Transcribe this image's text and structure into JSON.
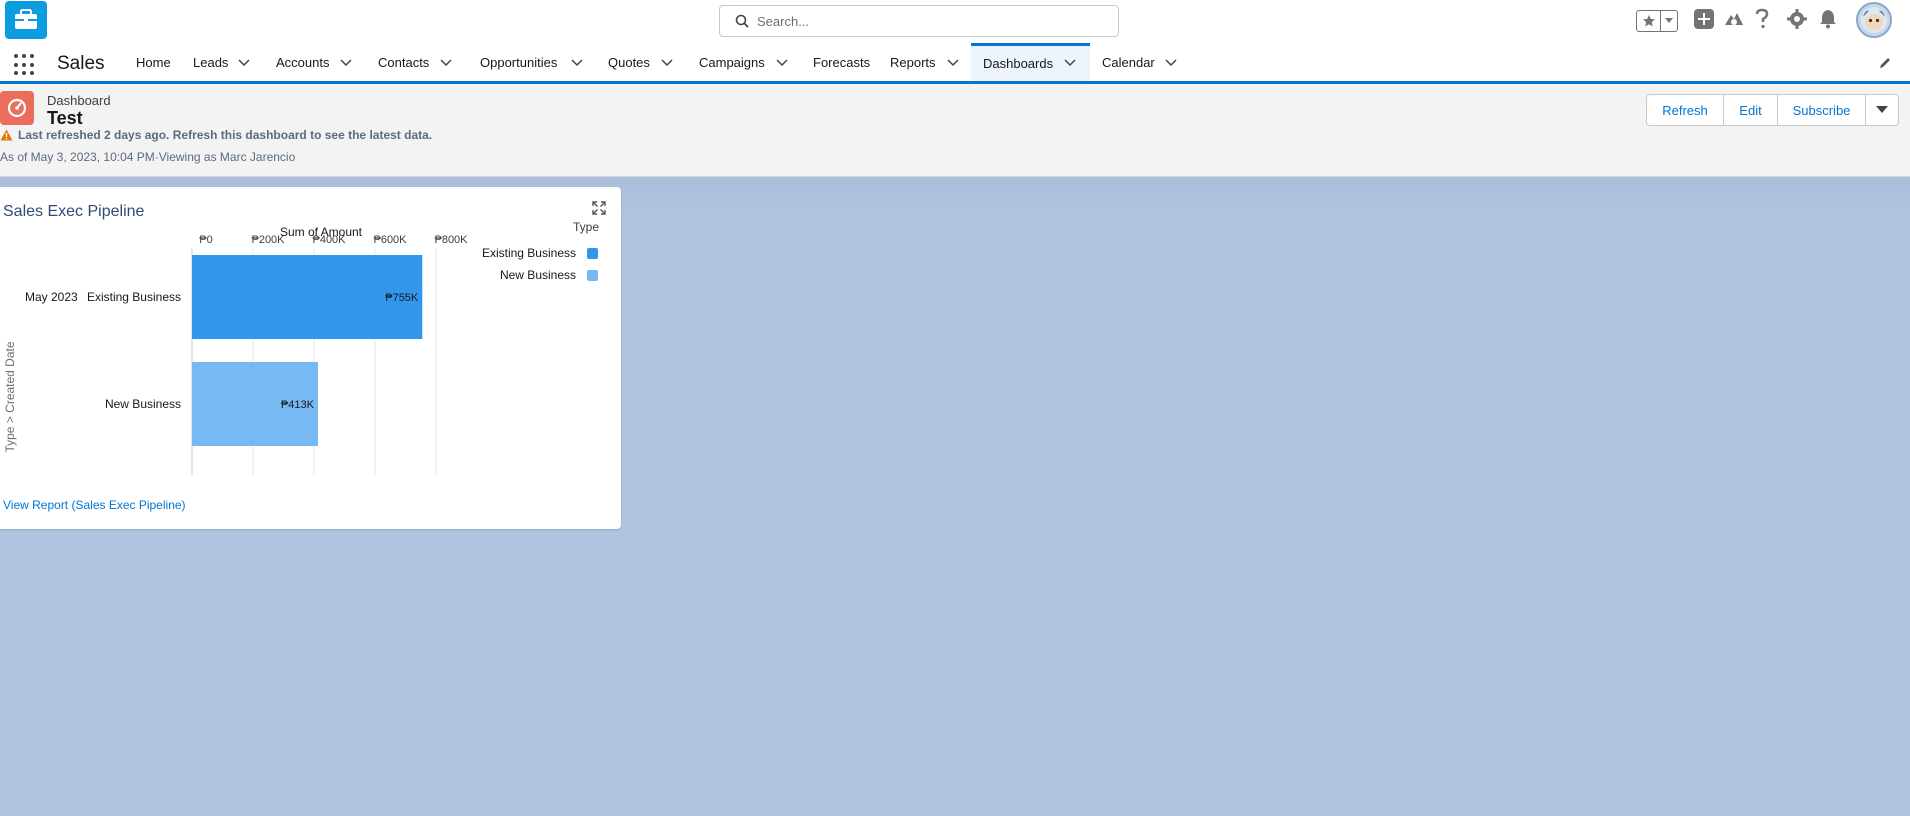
{
  "search": {
    "placeholder": "Search..."
  },
  "app": {
    "name": "Sales"
  },
  "nav": {
    "items": [
      {
        "label": "Home",
        "has_menu": false
      },
      {
        "label": "Leads",
        "has_menu": true
      },
      {
        "label": "Accounts",
        "has_menu": true
      },
      {
        "label": "Contacts",
        "has_menu": true
      },
      {
        "label": "Opportunities",
        "has_menu": true
      },
      {
        "label": "Quotes",
        "has_menu": true
      },
      {
        "label": "Campaigns",
        "has_menu": true
      },
      {
        "label": "Forecasts",
        "has_menu": false
      },
      {
        "label": "Reports",
        "has_menu": true
      },
      {
        "label": "Dashboards",
        "has_menu": true,
        "active": true
      },
      {
        "label": "Calendar",
        "has_menu": true
      }
    ]
  },
  "dashboard": {
    "type_label": "Dashboard",
    "title": "Test",
    "warning": "Last refreshed 2 days ago. Refresh this dashboard to see the latest data.",
    "as_of": "As of May 3, 2023, 10:04 PM·Viewing as Marc Jarencio",
    "buttons": {
      "refresh": "Refresh",
      "edit": "Edit",
      "subscribe": "Subscribe"
    }
  },
  "widget": {
    "title": "Sales Exec Pipeline",
    "view_report": "View Report (Sales Exec Pipeline)"
  },
  "colors": {
    "accent": "#0176d3",
    "existing_business": "#3296ed",
    "new_business": "#77b9f2",
    "dashboard_icon": "#eb6d5b"
  },
  "chart_data": {
    "type": "bar",
    "orientation": "horizontal",
    "title": "Sum of Amount",
    "xlabel": "Sum of Amount",
    "ylabel": "Type > Created Date",
    "group_label": "May 2023",
    "categories": [
      "Existing Business",
      "New Business"
    ],
    "values": [
      755000,
      413000
    ],
    "data_labels": [
      "₱755K",
      "₱413K"
    ],
    "xlim": [
      0,
      800000
    ],
    "ticks": [
      0,
      200000,
      400000,
      600000,
      800000
    ],
    "tick_labels": [
      "₱0",
      "₱200K",
      "₱400K",
      "₱600K",
      "₱800K"
    ],
    "legend_title": "Type",
    "legend": [
      "Existing Business",
      "New Business"
    ],
    "legend_position": "right",
    "grid": true
  }
}
